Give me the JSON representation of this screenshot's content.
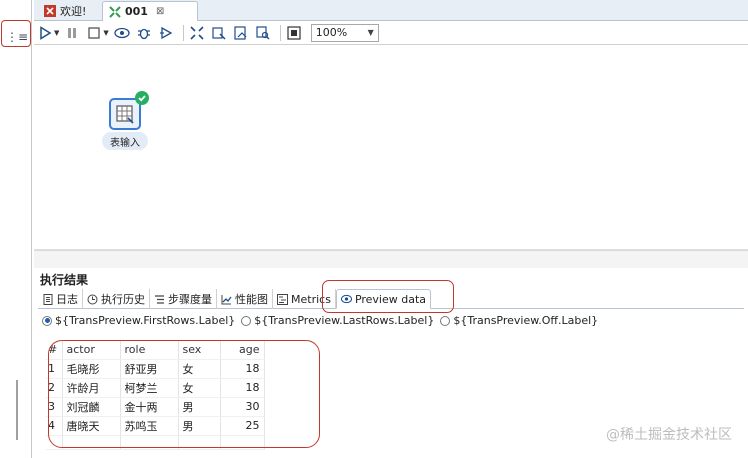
{
  "tabs": [
    {
      "label": "欢迎!",
      "icon": "spoon-icon"
    },
    {
      "label": "001",
      "icon": "transformation-icon",
      "close": "⊠"
    }
  ],
  "toolbar": {
    "zoom": "100%"
  },
  "canvas": {
    "step_label": "表输入"
  },
  "results": {
    "title": "执行结果",
    "tabs": [
      "日志",
      "执行历史",
      "步骤度量",
      "性能图",
      "Metrics",
      "Preview data"
    ],
    "radios": [
      {
        "label": "${TransPreview.FirstRows.Label}",
        "checked": true
      },
      {
        "label": "${TransPreview.LastRows.Label}",
        "checked": false
      },
      {
        "label": "${TransPreview.Off.Label}",
        "checked": false
      }
    ],
    "columns": [
      "#",
      "actor",
      "role",
      "sex",
      "age"
    ],
    "rows": [
      [
        "1",
        "毛晓彤",
        "舒亚男",
        "女",
        "18"
      ],
      [
        "2",
        "许龄月",
        "柯梦兰",
        "女",
        "18"
      ],
      [
        "3",
        "刘冠麟",
        "金十两",
        "男",
        "30"
      ],
      [
        "4",
        "唐晓天",
        "苏鸣玉",
        "男",
        "25"
      ]
    ]
  },
  "watermark": "@稀土掘金技术社区",
  "colors": {
    "accent": "#3a7bd5",
    "highlight": "#c0392b",
    "success": "#27ae60"
  }
}
